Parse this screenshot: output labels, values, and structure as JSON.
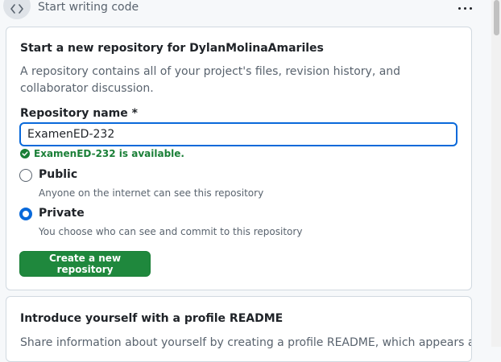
{
  "header": {
    "title": "Start writing code",
    "code_icon": "code-icon",
    "more_icon": "kebab-horizontal-icon"
  },
  "new_repo_card": {
    "title": "Start a new repository for DylanMolinaAmariles",
    "description": "A repository contains all of your project's files, revision history, and collaborator discussion.",
    "name_label": "Repository name *",
    "name_value": "ExamenED-232",
    "availability": "ExamenED-232 is available.",
    "visibility_options": [
      {
        "label": "Public",
        "description": "Anyone on the internet can see this repository",
        "selected": false
      },
      {
        "label": "Private",
        "description": "You choose who can see and commit to this repository",
        "selected": true
      }
    ],
    "create_button": "Create a new repository"
  },
  "readme_card": {
    "title": "Introduce yourself with a profile README",
    "description": "Share information about yourself by creating a profile README, which appears at"
  },
  "colors": {
    "accent": "#0969da",
    "success": "#1a7f37",
    "button_primary": "#1f883d"
  }
}
